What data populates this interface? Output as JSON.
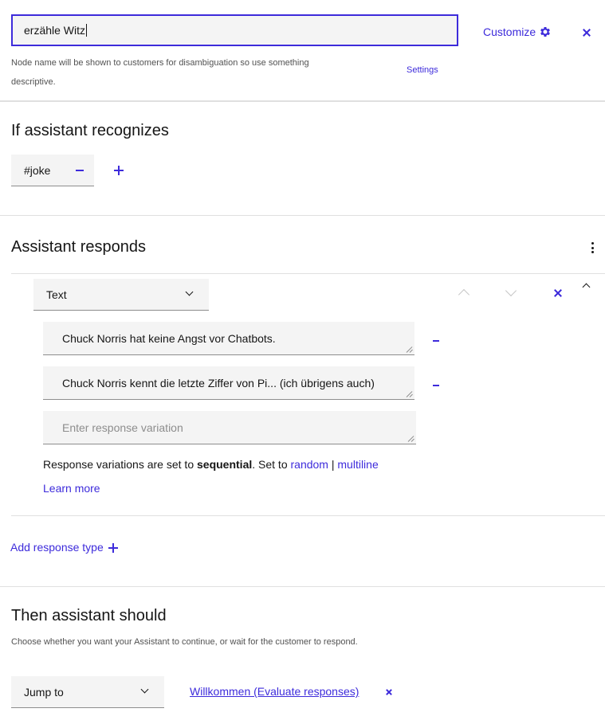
{
  "header": {
    "node_name_value": "erzähle Witz",
    "helper_text": "Node name will be shown to customers for disambiguation so use something descriptive.",
    "customize_label": "Customize",
    "settings_label": "Settings"
  },
  "recognizes": {
    "title": "If assistant recognizes",
    "condition": "#joke"
  },
  "responds": {
    "title": "Assistant responds",
    "response_type": "Text",
    "variations": [
      "Chuck Norris hat keine Angst vor Chatbots.",
      "Chuck Norris kennt die letzte Ziffer von Pi... (ich übrigens auch)"
    ],
    "new_variation_placeholder": "Enter response variation",
    "variation_text_prefix": "Response variations are set to ",
    "variation_mode": "sequential",
    "variation_text_mid": ". Set to ",
    "option_random": "random",
    "option_separator": "|",
    "option_multiline": "multiline",
    "learn_more": "Learn more",
    "add_response_type": "Add response type"
  },
  "then": {
    "title": "Then assistant should",
    "helper_text": "Choose whether you want your Assistant to continue, or wait for the customer to respond.",
    "action": "Jump to",
    "target": "Willkommen (Evaluate responses)"
  },
  "colors": {
    "accent": "#3d2bdb",
    "field_bg": "#f4f4f4",
    "divider": "#e0e0e0"
  }
}
